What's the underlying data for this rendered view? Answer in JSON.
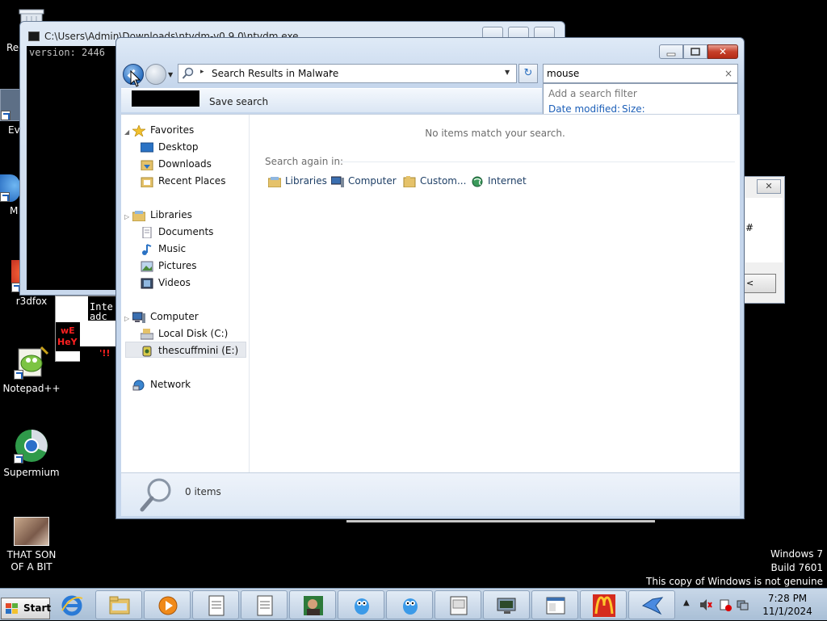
{
  "desktop_icons": {
    "recycle": "Rec",
    "every": "Eve",
    "m": "M",
    "r3dfox": "r3dfox",
    "notepadpp": "Notepad++",
    "supermium": "Supermium",
    "son_line1": "THAT SON",
    "son_line2": "OF A BIT"
  },
  "console": {
    "title": "C:\\Users\\Admin\\Downloads\\ntvdm-v0.9.0\\ntvdm.exe",
    "line1": "version: 2446"
  },
  "strip": {
    "text1": "Inte",
    "text2": "adc",
    "red1": "wE",
    "red2": "HeY",
    "red3": "'!!"
  },
  "dialog": {
    "close_glyph": "✕",
    "hash": "#",
    "button": "<"
  },
  "explorer": {
    "close_glyph": "✕",
    "address": {
      "crumb": "Search Results in Malware",
      "sep": "▸"
    },
    "refresh_glyph": "↻",
    "search": {
      "value": "mouse",
      "clear": "×",
      "hint": "Add a search filter",
      "filter1": "Date modified:",
      "filter2": "Size:"
    },
    "cmdbar": {
      "save": "Save search"
    },
    "nav": {
      "favorites": "Favorites",
      "desktop": "Desktop",
      "downloads": "Downloads",
      "recent": "Recent Places",
      "libraries": "Libraries",
      "documents": "Documents",
      "music": "Music",
      "pictures": "Pictures",
      "videos": "Videos",
      "computer": "Computer",
      "localdisk": "Local Disk (C:)",
      "thescuffmini": "thescuffmini (E:)",
      "network": "Network"
    },
    "content": {
      "noitems": "No items match your search.",
      "searchagain": "Search again in:",
      "targets": [
        "Libraries",
        "Computer",
        "Custom...",
        "Internet"
      ]
    },
    "details": {
      "count": "0 items"
    }
  },
  "watermark": {
    "line1": "Windows 7",
    "line2": "Build 7601",
    "line3": "This copy of Windows is not genuine"
  },
  "taskbar": {
    "start": "Start",
    "time": "7:28 PM",
    "date": "11/1/2024"
  },
  "colors": {
    "accent": "#1c5fb8",
    "close_red": "#c6402a",
    "taskbar": "#bfd0e3"
  }
}
